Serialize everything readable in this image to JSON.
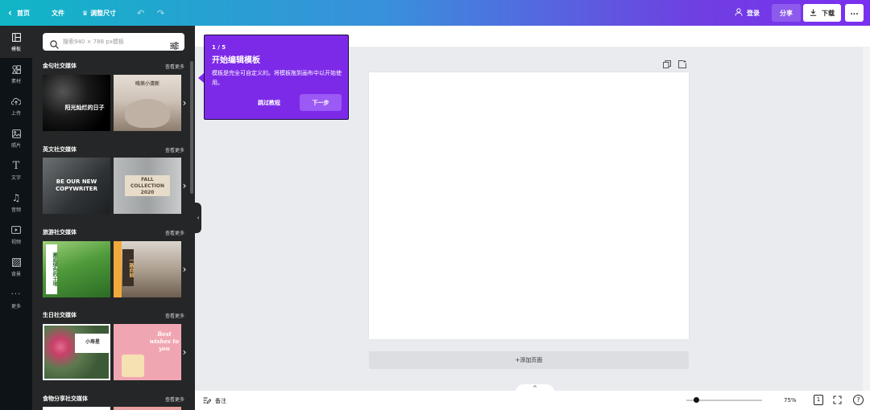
{
  "topbar": {
    "back_label": "首页",
    "file_label": "文件",
    "resize_label": "调整尺寸",
    "login_label": "登录",
    "share_label": "分享",
    "download_label": "下载",
    "more_label": "..."
  },
  "rail": {
    "items": [
      {
        "label": "模板",
        "icon": "template-icon"
      },
      {
        "label": "素材",
        "icon": "elements-icon"
      },
      {
        "label": "上传",
        "icon": "upload-icon"
      },
      {
        "label": "照片",
        "icon": "photo-icon"
      },
      {
        "label": "文字",
        "icon": "text-icon"
      },
      {
        "label": "音频",
        "icon": "audio-icon"
      },
      {
        "label": "视频",
        "icon": "video-icon"
      },
      {
        "label": "背景",
        "icon": "background-icon"
      },
      {
        "label": "更多",
        "icon": "more-icon"
      }
    ]
  },
  "search": {
    "placeholder": "搜索940 × 788 px模板"
  },
  "sections": [
    {
      "title": "金句社交媒体",
      "more": "查看更多",
      "thumbs": [
        "阳光灿烂的日子",
        "唯美小清新"
      ]
    },
    {
      "title": "英文社交媒体",
      "more": "查看更多",
      "thumbs": [
        "BE OUR NEW COPYWRITER",
        "FALL COLLECTION 2020"
      ]
    },
    {
      "title": "旅游社交媒体",
      "more": "查看更多",
      "thumbs": [
        "邂逅绿色的土地",
        "一路向前"
      ]
    },
    {
      "title": "生日社交媒体",
      "more": "查看更多",
      "thumbs": [
        "小寿星",
        "Best wishes to you"
      ]
    },
    {
      "title": "食物分享社交媒体",
      "more": "查看更多",
      "thumbs": []
    }
  ],
  "popover": {
    "step": "1 / 5",
    "title": "开始编辑模板",
    "body": "模板是完全可自定义的。将模板拖到画布中以开始使用。",
    "skip_label": "跳过教程",
    "next_label": "下一步"
  },
  "canvas": {
    "add_page_label": "+添加页面"
  },
  "bottombar": {
    "notes_label": "备注",
    "zoom": "75%",
    "page_count": "1",
    "help_label": "?",
    "up_label": "^"
  },
  "colors": {
    "accent": "#7d2ae8",
    "panel_bg": "#252627",
    "rail_bg": "#0e1318"
  }
}
